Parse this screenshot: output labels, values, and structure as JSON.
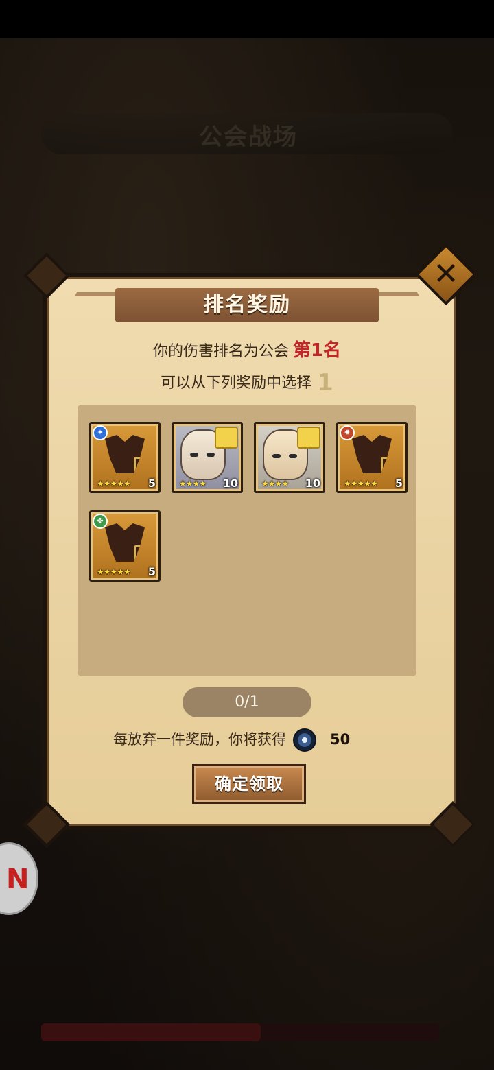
{
  "background": {
    "banner_title": "公会战场",
    "banner_subtitle": "",
    "bottom_texts": [
      "",
      ""
    ]
  },
  "dialog": {
    "title": "排名奖励",
    "rank_prefix": "你的伤害排名为公会",
    "rank_value": "第1名",
    "choose_prefix": "可以从下列奖励中选择",
    "choose_count": "1",
    "items": [
      {
        "type": "armor",
        "badge_color": "#2f6fd6",
        "badge_icon": "blue-element-icon",
        "stars": "★★★★★",
        "level": "5"
      },
      {
        "type": "hero",
        "stars": "★★★★",
        "level": "10"
      },
      {
        "type": "hero",
        "stars": "★★★★",
        "level": "10"
      },
      {
        "type": "armor",
        "badge_color": "#c2472a",
        "badge_icon": "red-element-icon",
        "stars": "★★★★★",
        "level": "5"
      },
      {
        "type": "armor",
        "badge_color": "#3d9a4a",
        "badge_icon": "green-element-icon",
        "stars": "★★★★★",
        "level": "5"
      }
    ],
    "selection_progress": "0/1",
    "discard_text": "每放弃一件奖励，你将获得",
    "discard_amount": "50",
    "confirm_label": "确定领取"
  },
  "colors": {
    "rank_highlight": "#c0262a",
    "panel_bg": "#ead3a3",
    "star": "#ffd83a"
  }
}
